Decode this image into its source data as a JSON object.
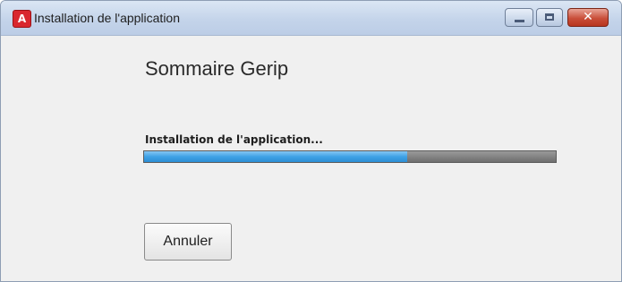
{
  "window": {
    "title": "Installation de l'application",
    "app_icon_glyph": "A",
    "app_icon_name": "adobe-air-icon",
    "controls": {
      "minimize_icon": "minimize-icon",
      "maximize_icon": "maximize-icon",
      "close_icon": "close-icon",
      "close_glyph": "✕"
    }
  },
  "main": {
    "heading": "Sommaire Gerip",
    "status_text": "Installation de l'application...",
    "progress": {
      "value": 0.64,
      "fill_color": "#3fa2e6",
      "track_color": "#7a7a7a"
    },
    "cancel_label": "Annuler"
  },
  "colors": {
    "titlebar": "#c4d4ea",
    "close_button": "#c94f3a",
    "app_icon": "#d9272e"
  }
}
